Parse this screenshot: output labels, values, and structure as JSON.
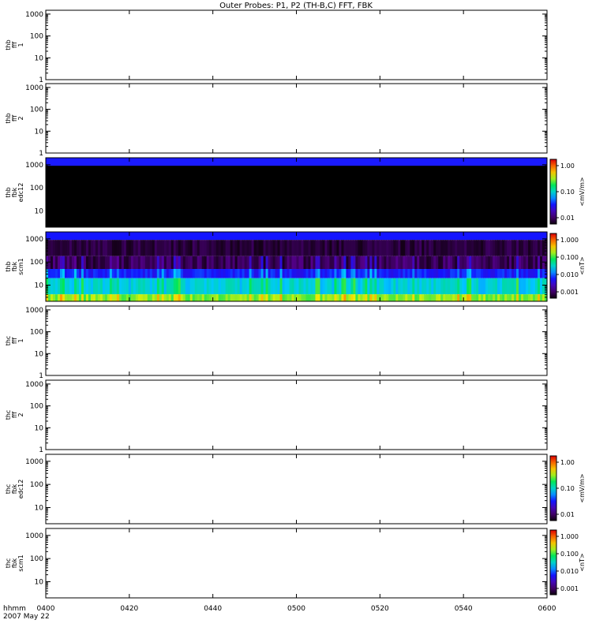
{
  "title": "Outer Probes: P1, P2 (TH-B,C) FFT, FBK",
  "footer": {
    "time_label": "hhmm",
    "date_label": "2007 May 22"
  },
  "x_ticks": [
    "0400",
    "0420",
    "0440",
    "0500",
    "0520",
    "0540",
    "0600"
  ],
  "colors": {
    "frame": "#000000",
    "blue_band": "#1a1aff",
    "black_fill": "#000000"
  },
  "chart_data": [
    {
      "type": "heatmap",
      "ylabel": [
        "thb",
        "fff",
        "1"
      ],
      "yscale": "log",
      "ylim": [
        1,
        1500
      ],
      "yticks": [
        "1000",
        "100",
        "10",
        "1"
      ],
      "has_data": false
    },
    {
      "type": "heatmap",
      "ylabel": [
        "thb",
        "fff",
        "2"
      ],
      "yscale": "log",
      "ylim": [
        1,
        1500
      ],
      "yticks": [
        "1000",
        "100",
        "10",
        "1"
      ],
      "has_data": false
    },
    {
      "type": "heatmap",
      "ylabel": [
        "thb",
        "fbk",
        "edc12"
      ],
      "yscale": "log",
      "ylim": [
        2,
        2000
      ],
      "yticks": [
        "1000",
        "100",
        "10"
      ],
      "has_data": true,
      "pattern": "edc",
      "colorbar": {
        "label": "<mV/m>",
        "ticks": [
          "1.00",
          "0.10",
          "0.01"
        ]
      }
    },
    {
      "type": "heatmap",
      "ylabel": [
        "thb",
        "fbk",
        "scm1"
      ],
      "yscale": "log",
      "ylim": [
        2,
        2000
      ],
      "yticks": [
        "1000",
        "100",
        "10"
      ],
      "has_data": true,
      "pattern": "scm",
      "colorbar": {
        "label": "<nT>",
        "ticks": [
          "1.000",
          "0.100",
          "0.010",
          "0.001"
        ]
      }
    },
    {
      "type": "heatmap",
      "ylabel": [
        "thc",
        "fff",
        "1"
      ],
      "yscale": "log",
      "ylim": [
        1,
        1500
      ],
      "yticks": [
        "1000",
        "100",
        "10",
        "1"
      ],
      "has_data": false
    },
    {
      "type": "heatmap",
      "ylabel": [
        "thc",
        "fff",
        "2"
      ],
      "yscale": "log",
      "ylim": [
        1,
        1500
      ],
      "yticks": [
        "1000",
        "100",
        "10",
        "1"
      ],
      "has_data": false
    },
    {
      "type": "heatmap",
      "ylabel": [
        "thc",
        "fbk",
        "edc12"
      ],
      "yscale": "log",
      "ylim": [
        2,
        2000
      ],
      "yticks": [
        "1000",
        "100",
        "10"
      ],
      "has_data": false,
      "colorbar": {
        "label": "<mV/m>",
        "ticks": [
          "1.00",
          "0.10",
          "0.01"
        ]
      }
    },
    {
      "type": "heatmap",
      "ylabel": [
        "thc",
        "fbk",
        "scm1"
      ],
      "yscale": "log",
      "ylim": [
        2,
        2000
      ],
      "yticks": [
        "1000",
        "100",
        "10"
      ],
      "has_data": false,
      "colorbar": {
        "label": "<nT>",
        "ticks": [
          "1.000",
          "0.100",
          "0.010",
          "0.001"
        ]
      }
    }
  ]
}
